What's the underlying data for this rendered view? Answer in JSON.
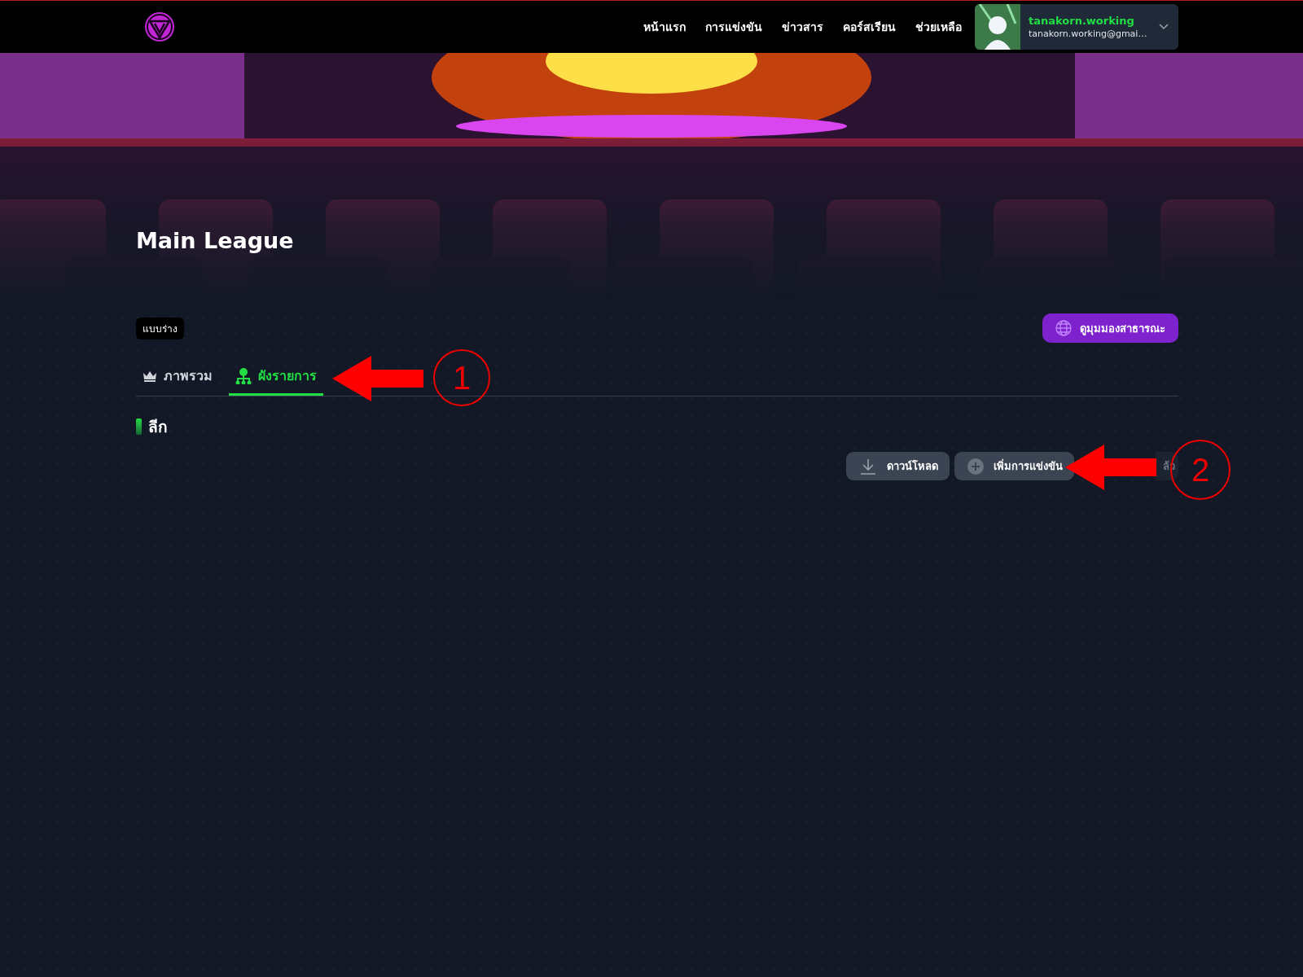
{
  "header": {
    "nav": [
      {
        "label": "หน้าแรก"
      },
      {
        "label": "การแข่งขัน"
      },
      {
        "label": "ข่าวสาร"
      },
      {
        "label": "คอร์สเรียน"
      },
      {
        "label": "ช่วยเหลือ"
      }
    ],
    "user": {
      "name": "tanakorn.working",
      "email": "tanakorn.working@gmai…"
    }
  },
  "hero": {
    "kind": "picture",
    "title": "Main League"
  },
  "status_badge": "แบบร่าง",
  "public_view_button": "ดูมุมมองสาธารณะ",
  "tabs": [
    {
      "label": "ภาพรวม",
      "kind": "crown",
      "selected": false
    },
    {
      "label": "ผังรายการ",
      "kind": "tree",
      "selected": true
    }
  ],
  "section_title": "ลีก",
  "actions": [
    {
      "label": "ดาวน์โหลด",
      "kind": "download"
    },
    {
      "label": "เพิ่มการแข่งขัน",
      "kind": "add"
    },
    {
      "label": "ล้ว",
      "kind": "plain"
    }
  ],
  "annotations": [
    {
      "label": "1"
    },
    {
      "label": "2"
    }
  ]
}
